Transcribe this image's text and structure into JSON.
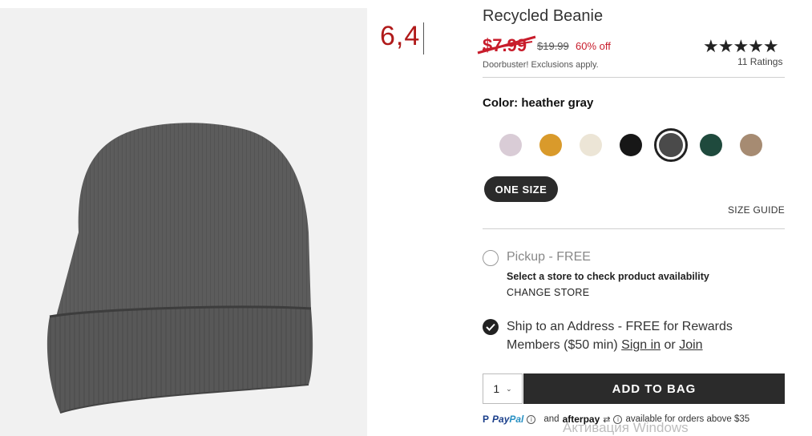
{
  "annotation": {
    "text": "6,4"
  },
  "product": {
    "title": "Recycled Beanie",
    "sale_price": "$7.99",
    "original_price": "$19.99",
    "discount": "60% off",
    "promo_note": "Doorbuster! Exclusions apply.",
    "rating_stars": "★★★★★",
    "ratings_count": "11 Ratings"
  },
  "color": {
    "label": "Color: heather gray",
    "swatches": [
      {
        "name": "lilac",
        "hex": "#d9ccd6"
      },
      {
        "name": "mustard",
        "hex": "#d99a2b"
      },
      {
        "name": "cream",
        "hex": "#ece5d6"
      },
      {
        "name": "black",
        "hex": "#171717"
      },
      {
        "name": "heather gray",
        "hex": "#4a4a4a",
        "selected": true
      },
      {
        "name": "dark green",
        "hex": "#1f4a3d"
      },
      {
        "name": "tan",
        "hex": "#a68b72"
      }
    ]
  },
  "size": {
    "option": "ONE SIZE",
    "guide": "SIZE GUIDE"
  },
  "fulfillment": {
    "pickup_label": "Pickup - FREE",
    "store_message": "Select a store to check product availability",
    "change_store": "CHANGE STORE",
    "ship_prefix": "Ship to an Address - FREE for Rewards Members ($50 min)",
    "sign_in": "Sign in",
    "or": "or",
    "join": "Join"
  },
  "cart": {
    "quantity": "1",
    "add_to_bag": "ADD TO BAG"
  },
  "payment": {
    "paypal_a": "Pay",
    "paypal_b": "Pal",
    "and": "and",
    "afterpay": "afterpay",
    "available_text": "available for orders above $35"
  },
  "watermark": "Активация Windows"
}
